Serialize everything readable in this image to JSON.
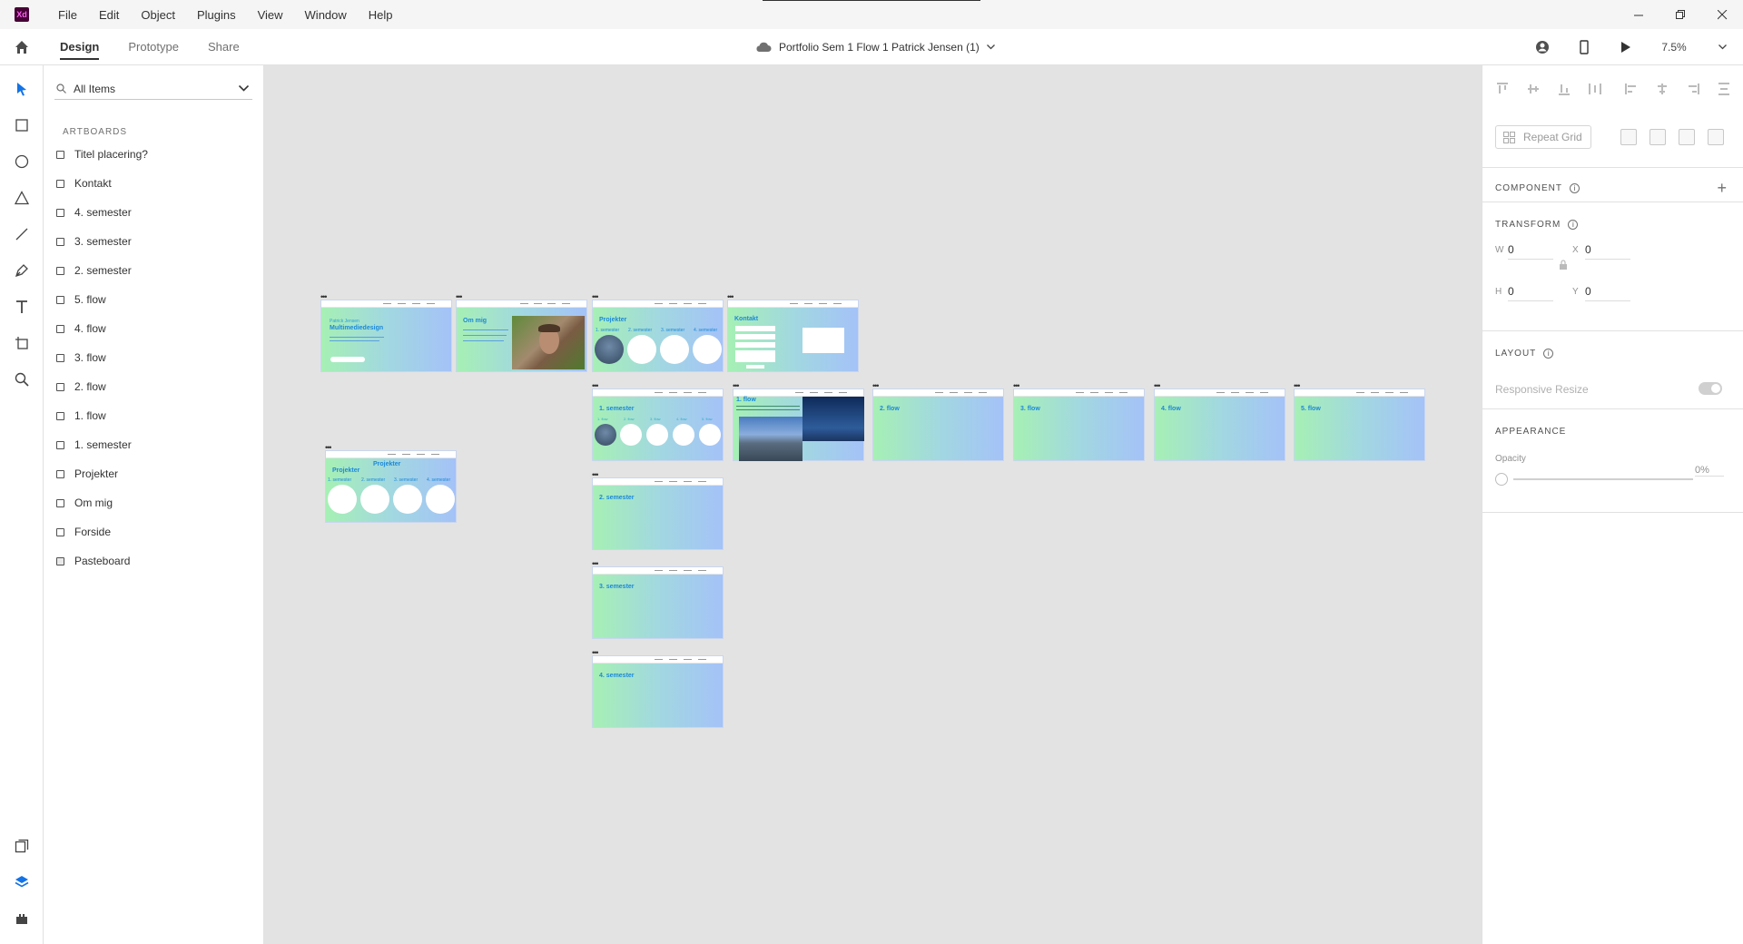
{
  "menubar": {
    "app_icon_label": "Xd",
    "items": [
      "File",
      "Edit",
      "Object",
      "Plugins",
      "View",
      "Window",
      "Help"
    ],
    "window_controls": [
      "minimize-icon",
      "restore-icon",
      "close-icon"
    ]
  },
  "toolbar": {
    "tabs": [
      "Design",
      "Prototype",
      "Share"
    ],
    "active_tab": "Design",
    "document_title": "Portfolio Sem 1 Flow 1 Patrick Jensen (1)",
    "zoom": "7.5%",
    "right_icons": [
      "share-user-icon",
      "mobile-preview-icon",
      "play-icon",
      "chevron-down-icon"
    ]
  },
  "left_tools": [
    "select-icon",
    "rectangle-icon",
    "ellipse-icon",
    "triangle-icon",
    "line-icon",
    "pen-icon",
    "text-icon",
    "artboard-icon",
    "zoom-icon",
    "assets-icon",
    "layers-icon",
    "plugins-icon"
  ],
  "layers": {
    "search_placeholder": "All Items",
    "section_label": "ARTBOARDS",
    "items": [
      "Titel placering?",
      "Kontakt",
      "4. semester",
      "3. semester",
      "2. semester",
      "5. flow",
      "4. flow",
      "3. flow",
      "2. flow",
      "1. flow",
      "1. semester",
      "Projekter",
      "Om mig",
      "Forside",
      "Pasteboard"
    ]
  },
  "artboards": [
    {
      "title": "Multimediedesign",
      "subtitle": "Patrick Jensen"
    },
    {
      "title": "Om mig"
    },
    {
      "title": "Projekter",
      "circle_labels": [
        "1. semester",
        "2. semester",
        "3. semester",
        "4. semester"
      ]
    },
    {
      "title": "Kontakt"
    },
    {
      "title": "1. semester",
      "circle_labels": [
        "1. flow",
        "2. flow",
        "3. flow",
        "4. flow",
        "5. flow"
      ]
    },
    {
      "title": "1. flow"
    },
    {
      "title": "2. flow"
    },
    {
      "title": "3. flow"
    },
    {
      "title": "4. flow"
    },
    {
      "title": "5. flow"
    },
    {
      "title": "2. semester"
    },
    {
      "title": "3. semester"
    },
    {
      "title": "4. semester"
    },
    {
      "title": "Projekter",
      "header": "Projekter",
      "circle_labels": [
        "1. semester",
        "2. semester",
        "3. semester",
        "4. semester"
      ]
    }
  ],
  "properties": {
    "repeat_grid_label": "Repeat Grid",
    "component_label": "COMPONENT",
    "transform_label": "TRANSFORM",
    "w_label": "W",
    "w_value": "0",
    "x_label": "X",
    "x_value": "0",
    "h_label": "H",
    "h_value": "0",
    "y_label": "Y",
    "y_value": "0",
    "layout_label": "LAYOUT",
    "responsive_resize_label": "Responsive Resize",
    "appearance_label": "APPEARANCE",
    "opacity_label": "Opacity",
    "opacity_value": "0%"
  },
  "colors": {
    "artboard_gradient_start": "#a6f0b4",
    "artboard_gradient_end": "#a4c2f8",
    "artboard_title": "#1c88d9",
    "canvas_bg": "#e3e3e3",
    "accent": "#1473e6"
  }
}
